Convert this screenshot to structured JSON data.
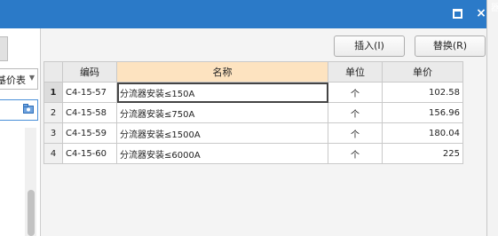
{
  "window": {
    "maximize_icon": "maximize-icon",
    "close_glyph": "×"
  },
  "background_edge_text": "器",
  "left_panel": {
    "price_combo_text": "基价表",
    "search_icon": "search-folder-icon"
  },
  "toolbar": {
    "insert_label": "插入(I)",
    "replace_label": "替换(R)"
  },
  "table": {
    "columns": [
      "编码",
      "名称",
      "单位",
      "单价"
    ],
    "active_column": "名称",
    "rows": [
      {
        "num": "1",
        "code": "C4-15-57",
        "name": "分流器安装≤150A",
        "unit": "个",
        "price": "102.58"
      },
      {
        "num": "2",
        "code": "C4-15-58",
        "name": "分流器安装≤750A",
        "unit": "个",
        "price": "156.96"
      },
      {
        "num": "3",
        "code": "C4-15-59",
        "name": "分流器安装≤1500A",
        "unit": "个",
        "price": "180.04"
      },
      {
        "num": "4",
        "code": "C4-15-60",
        "name": "分流器安装≤6000A",
        "unit": "个",
        "price": "225"
      }
    ]
  }
}
